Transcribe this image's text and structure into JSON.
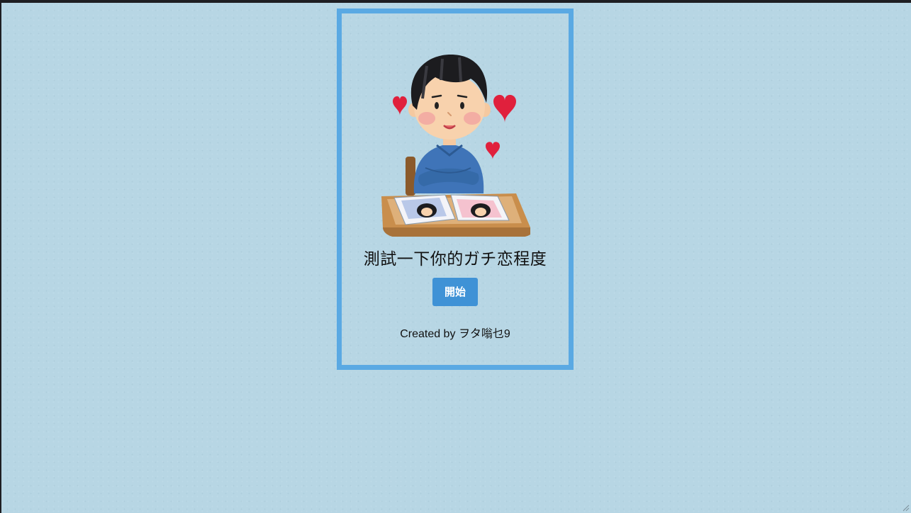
{
  "card": {
    "title": "測試一下你的ガチ恋程度",
    "start_label": "開始",
    "credit": "Created by ヲタ嗡乜9"
  },
  "colors": {
    "background": "#b7d6e4",
    "card_border": "#5aa9e3",
    "button": "#3f92d6",
    "heart": "#e0203c"
  },
  "illustration": {
    "icon": "boy-with-photo-album-and-hearts-illustration"
  }
}
